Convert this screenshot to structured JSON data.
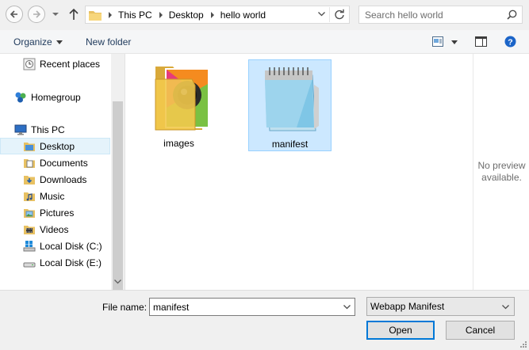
{
  "address_bar": {
    "breadcrumb": [
      "This PC",
      "Desktop",
      "hello world"
    ],
    "search_placeholder": "Search hello world"
  },
  "toolbar": {
    "organize_label": "Organize",
    "new_folder_label": "New folder"
  },
  "nav_pane": {
    "items": [
      {
        "label": "Recent places",
        "icon": "recent-places-icon"
      },
      {
        "label": "Homegroup",
        "icon": "homegroup-icon"
      },
      {
        "label": "This PC",
        "icon": "computer-icon"
      },
      {
        "label": "Desktop",
        "icon": "desktop-folder-icon",
        "selected": true
      },
      {
        "label": "Documents",
        "icon": "documents-folder-icon"
      },
      {
        "label": "Downloads",
        "icon": "downloads-folder-icon"
      },
      {
        "label": "Music",
        "icon": "music-folder-icon"
      },
      {
        "label": "Pictures",
        "icon": "pictures-folder-icon"
      },
      {
        "label": "Videos",
        "icon": "videos-folder-icon"
      },
      {
        "label": "Local Disk (C:)",
        "icon": "windows-drive-icon"
      },
      {
        "label": "Local Disk (E:)",
        "icon": "drive-icon"
      }
    ]
  },
  "content": {
    "files": [
      {
        "name": "images",
        "type": "folder",
        "icon": "photo-folder-icon"
      },
      {
        "name": "manifest",
        "type": "file",
        "icon": "notepad-icon",
        "selected": true
      }
    ]
  },
  "preview": {
    "line1": "No preview",
    "line2": "available."
  },
  "bottom": {
    "file_name_label": "File name:",
    "file_name_value": "manifest",
    "file_type_value": "Webapp Manifest",
    "open_label": "Open",
    "cancel_label": "Cancel"
  },
  "colors": {
    "selection_bg": "#cce8ff",
    "selection_border": "#99d1ff",
    "accent": "#0078d7",
    "toolbar_text": "#1e395b"
  }
}
